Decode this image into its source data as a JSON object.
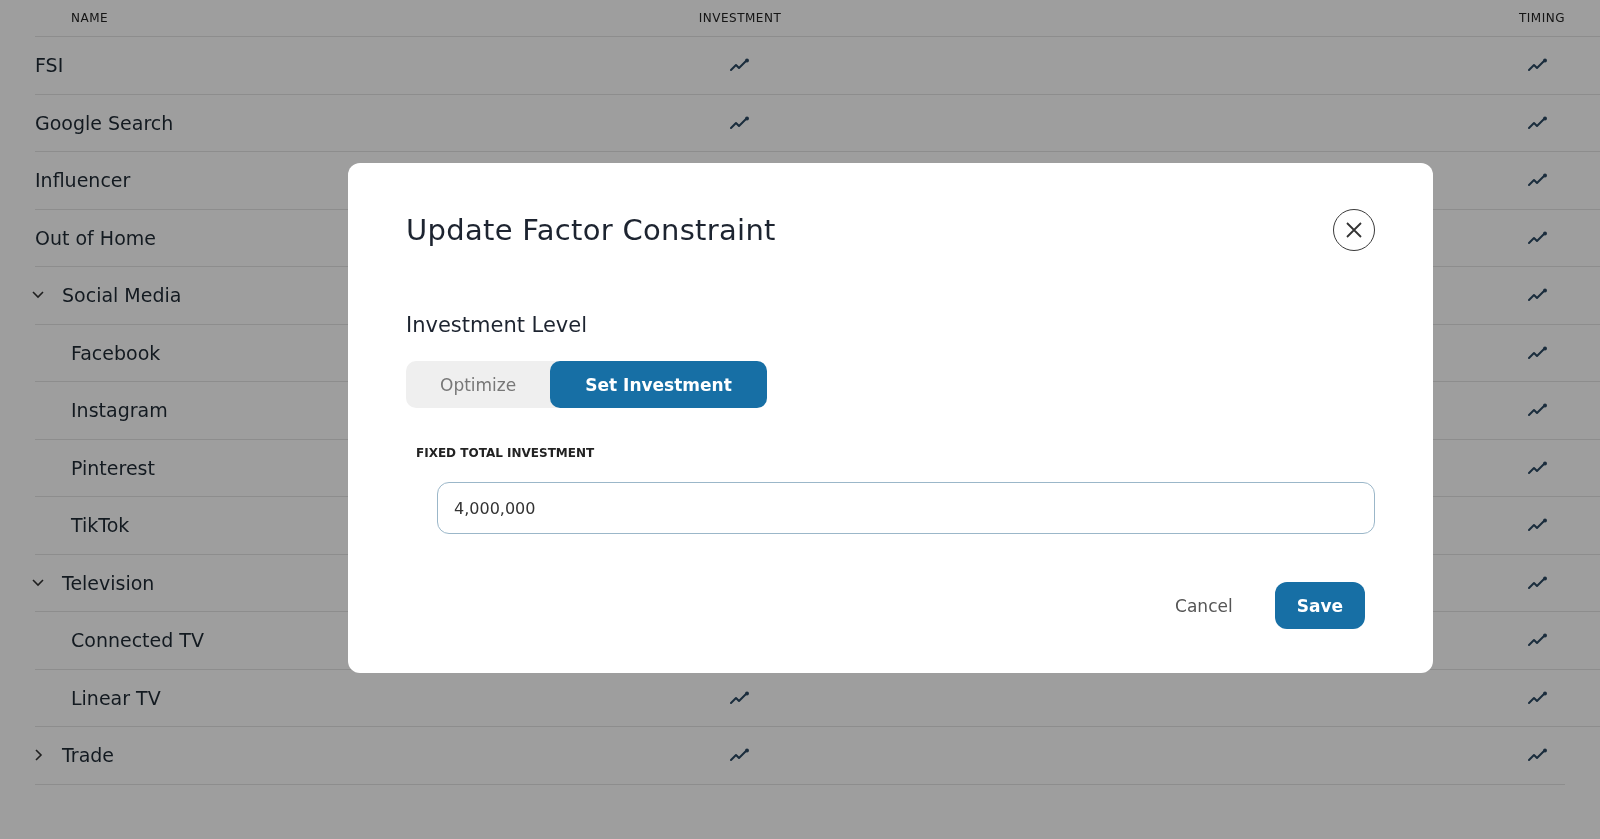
{
  "table": {
    "columns": [
      "NAME",
      "INVESTMENT",
      "TIMING"
    ],
    "rows": [
      {
        "name": "FSI"
      },
      {
        "name": "Google Search"
      },
      {
        "name": "Influencer"
      },
      {
        "name": "Out of Home"
      },
      {
        "name": "Social Media",
        "expanded": true,
        "children": [
          {
            "name": "Facebook"
          },
          {
            "name": "Instagram"
          },
          {
            "name": "Pinterest"
          },
          {
            "name": "TikTok"
          }
        ]
      },
      {
        "name": "Television",
        "expanded": true,
        "children": [
          {
            "name": "Connected TV"
          },
          {
            "name": "Linear TV"
          }
        ]
      },
      {
        "name": "Trade",
        "expanded": false
      }
    ]
  },
  "dialog": {
    "title": "Update Factor Constraint",
    "section_label": "Investment Level",
    "options": [
      {
        "label": "Optimize",
        "selected": false
      },
      {
        "label": "Set Investment",
        "selected": true
      }
    ],
    "field_label": "FIXED TOTAL INVESTMENT",
    "field_value": "4,000,000",
    "buttons": [
      {
        "label": "Cancel",
        "kind": "text"
      },
      {
        "label": "Save",
        "kind": "primary"
      }
    ]
  }
}
